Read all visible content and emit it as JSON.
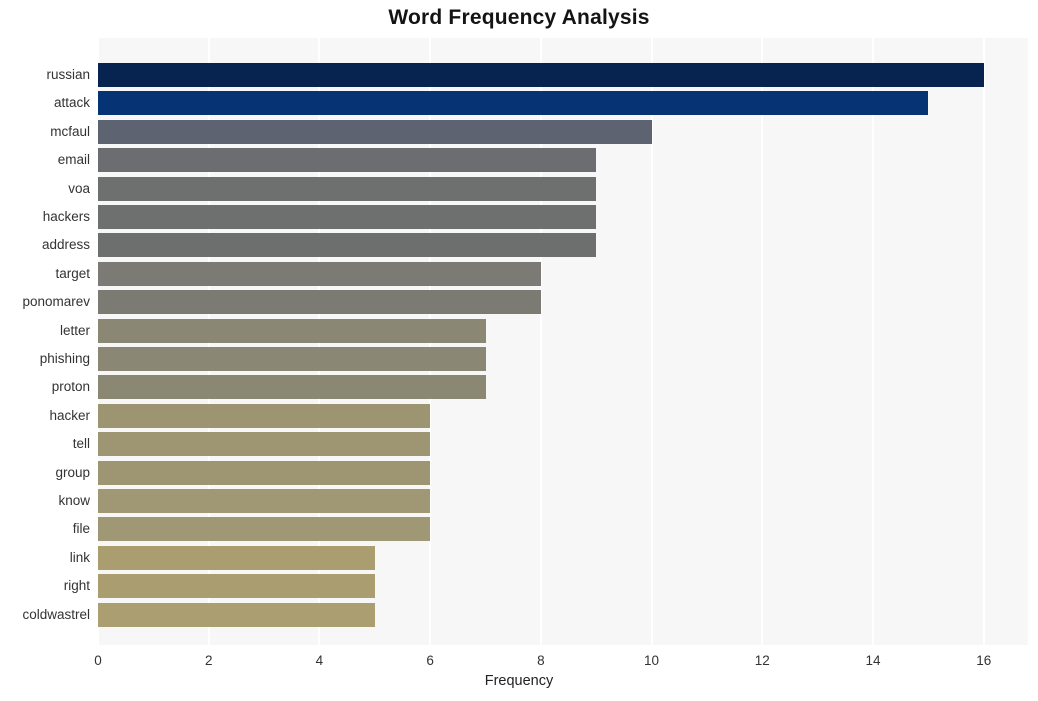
{
  "chart_data": {
    "type": "bar",
    "orientation": "horizontal",
    "title": "Word Frequency Analysis",
    "xlabel": "Frequency",
    "ylabel": "",
    "categories": [
      "russian",
      "attack",
      "mcfaul",
      "email",
      "voa",
      "hackers",
      "address",
      "target",
      "ponomarev",
      "letter",
      "phishing",
      "proton",
      "hacker",
      "tell",
      "group",
      "know",
      "file",
      "link",
      "right",
      "coldwastrel"
    ],
    "values": [
      16,
      15,
      10,
      9,
      9,
      9,
      9,
      8,
      8,
      7,
      7,
      7,
      6,
      6,
      6,
      6,
      6,
      5,
      5,
      5
    ],
    "bar_colors": [
      "#07234f",
      "#053373",
      "#5e6372",
      "#6b6d70",
      "#6e6f6f",
      "#6e6f6f",
      "#6d6e6e",
      "#7b7a74",
      "#7c7b73",
      "#8a8774",
      "#8a8774",
      "#8a8772",
      "#9d9472",
      "#9e9572",
      "#9e9572",
      "#a09774",
      "#a09774",
      "#aa9e71",
      "#aa9e71",
      "#ab9f72"
    ],
    "xlim": [
      0,
      16.8
    ],
    "xticks": [
      0,
      2,
      4,
      6,
      8,
      10,
      12,
      14,
      16
    ],
    "xtick_labels": [
      "0",
      "2",
      "4",
      "6",
      "8",
      "10",
      "12",
      "14",
      "16"
    ],
    "grid": true,
    "grid_color": "#ffffff",
    "plot_background": "#f7f7f7",
    "figure_background": "#ffffff",
    "legend": null
  }
}
